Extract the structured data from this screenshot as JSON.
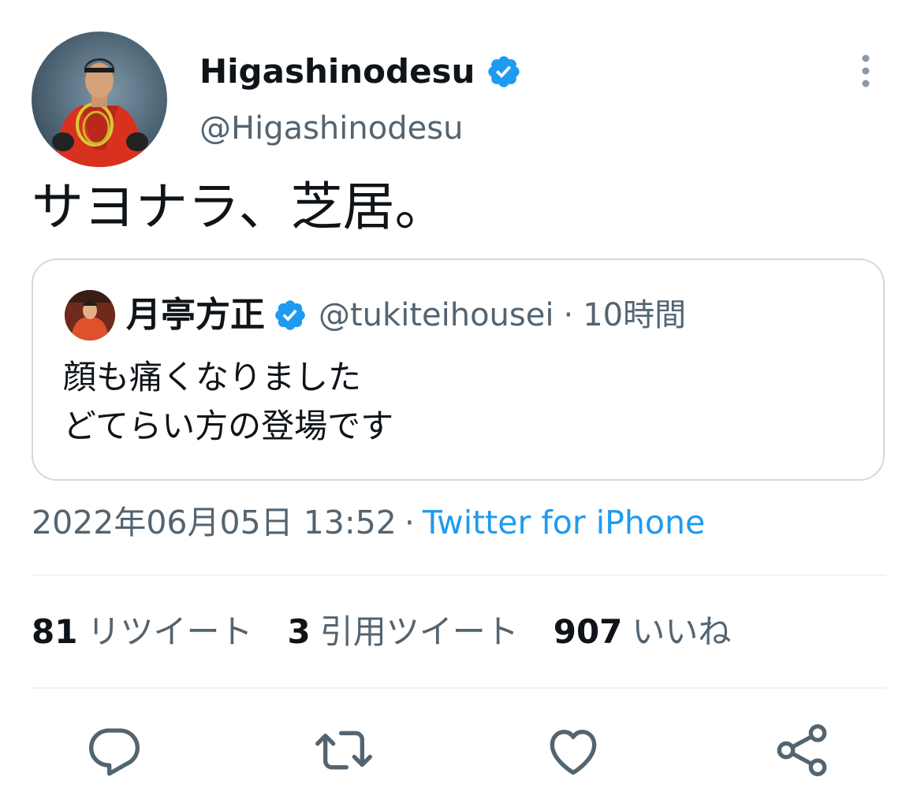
{
  "author": {
    "display_name": "Higashinodesu",
    "handle": "@Higashinodesu",
    "verified": true
  },
  "tweet": {
    "text": "サヨナラ、芝居。",
    "timestamp": "2022年06月05日 13:52",
    "separator": "·",
    "source": "Twitter for iPhone"
  },
  "quoted_tweet": {
    "display_name": "月亭方正",
    "handle": "@tukiteihousei",
    "separator": "·",
    "time_ago": "10時間",
    "lines": [
      "顔も痛くなりました",
      "どてらい方の登場です"
    ]
  },
  "stats": [
    {
      "count": "81",
      "label": "リツイート"
    },
    {
      "count": "3",
      "label": "引用ツイート"
    },
    {
      "count": "907",
      "label": "いいね"
    }
  ],
  "actions": [
    "reply-icon",
    "retweet-icon",
    "like-icon",
    "share-icon"
  ],
  "colors": {
    "accent": "#1d9bf0",
    "text": "#0f1419",
    "secondary": "#536471",
    "border": "#cfd9de"
  }
}
